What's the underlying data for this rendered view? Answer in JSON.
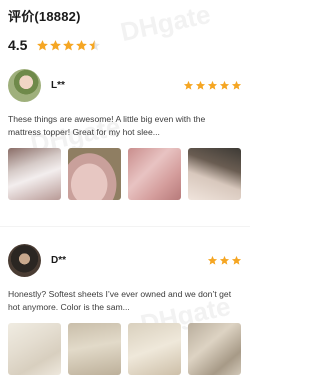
{
  "header": {
    "title": "评价(18882)",
    "rating": "4.5",
    "stars_value": 4.5,
    "stars_max": 5,
    "star_color": "#f5a623"
  },
  "reviews": [
    {
      "name": "L**",
      "stars": 5,
      "text": "These things are awesome! A little big even with the mattress topper! Great for my hot slee...",
      "photo_count": 4
    },
    {
      "name": "D**",
      "stars": 3,
      "text": "Honestly? Softest sheets I’ve ever owned and we don’t get hot anymore. Color is the sam...",
      "photo_count": 4
    }
  ],
  "colors": {
    "star": "#f5a623",
    "text": "#3c3c3c",
    "title": "#1a1a1a"
  }
}
